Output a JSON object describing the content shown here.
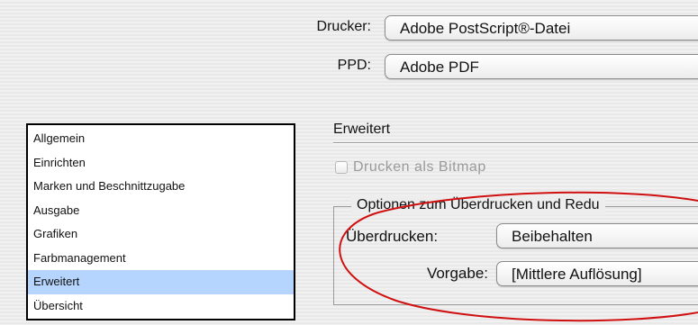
{
  "printer": {
    "label": "Drucker:",
    "value": "Adobe PostScript®-Datei"
  },
  "ppd": {
    "label": "PPD:",
    "value": "Adobe PDF"
  },
  "sidebar": {
    "items": [
      {
        "label": "Allgemein",
        "selected": false
      },
      {
        "label": "Einrichten",
        "selected": false
      },
      {
        "label": "Marken und Beschnittzugabe",
        "selected": false
      },
      {
        "label": "Ausgabe",
        "selected": false
      },
      {
        "label": "Grafiken",
        "selected": false
      },
      {
        "label": "Farbmanagement",
        "selected": false
      },
      {
        "label": "Erweitert",
        "selected": true
      },
      {
        "label": "Übersicht",
        "selected": false
      }
    ]
  },
  "advanced": {
    "title": "Erweitert",
    "print_as_bitmap": {
      "label": "Drucken als Bitmap",
      "checked": false,
      "enabled": false
    },
    "group_title": "Optionen zum Überdrucken und Redu",
    "overprint": {
      "label": "Überdrucken:",
      "value": "Beibehalten"
    },
    "preset": {
      "label": "Vorgabe:",
      "value": "[Mittlere Auflösung]"
    }
  },
  "colors": {
    "selection": "#b5d5ff",
    "annotation_ellipse": "#d01010"
  }
}
